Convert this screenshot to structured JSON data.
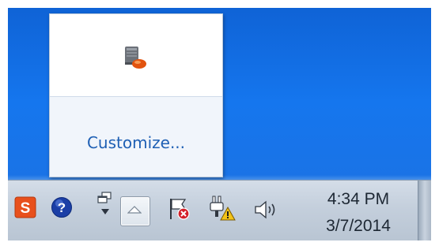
{
  "popup": {
    "customize_label": "Customize..."
  },
  "icons": {
    "popup_app": "server-app-icon",
    "sogou": "sogou-input-icon",
    "help": "help-icon",
    "language": "language-bar-icon",
    "overflow": "show-hidden-icons-chevron-up-icon",
    "action_center": "action-center-flag-error-icon",
    "network": "network-warning-icon",
    "volume": "speaker-volume-icon"
  },
  "clock": {
    "time": "4:34 PM",
    "date": "3/7/2014"
  },
  "colors": {
    "desktop": "#1576ee",
    "link": "#1e5fb4",
    "taskbar": "#c4cfdc",
    "sogou": "#e8501c",
    "help": "#1b3fa6"
  }
}
